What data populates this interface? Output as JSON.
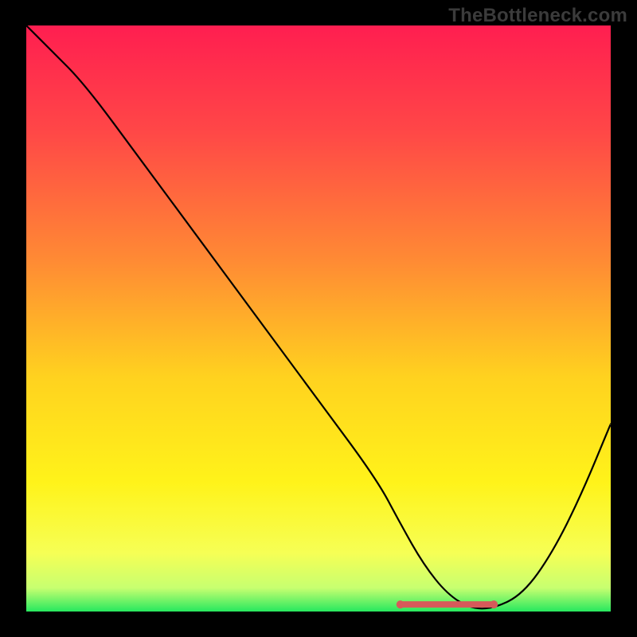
{
  "watermark": "TheBottleneck.com",
  "gradient": {
    "stops": [
      {
        "pct": 0,
        "color": "#ff1e50"
      },
      {
        "pct": 18,
        "color": "#ff4747"
      },
      {
        "pct": 40,
        "color": "#ff8a34"
      },
      {
        "pct": 60,
        "color": "#ffd21f"
      },
      {
        "pct": 78,
        "color": "#fff31a"
      },
      {
        "pct": 90,
        "color": "#f6ff55"
      },
      {
        "pct": 96,
        "color": "#c7ff70"
      },
      {
        "pct": 100,
        "color": "#27e85f"
      }
    ]
  },
  "curve": {
    "stroke": "#000000",
    "stroke_width": 2.2
  },
  "highlight": {
    "stroke": "#d65a5a",
    "stroke_width": 8,
    "cap_radius": 5
  },
  "chart_data": {
    "type": "line",
    "title": "",
    "xlabel": "",
    "ylabel": "",
    "xlim": [
      0,
      100
    ],
    "ylim": [
      0,
      100
    ],
    "grid": false,
    "legend": false,
    "annotations": [],
    "series": [
      {
        "name": "bottleneck-curve",
        "x": [
          0,
          4,
          10,
          20,
          30,
          40,
          50,
          60,
          64,
          68,
          72,
          76,
          80,
          85,
          90,
          95,
          100
        ],
        "y": [
          100,
          96,
          90,
          76.5,
          63,
          49.5,
          36,
          22.5,
          15,
          8,
          3,
          0.5,
          0.5,
          3,
          10,
          20,
          32
        ]
      },
      {
        "name": "optimal-range-highlight",
        "x": [
          64,
          80
        ],
        "y": [
          1.2,
          1.2
        ]
      }
    ],
    "highlight_range": {
      "x_start": 64,
      "x_end": 80
    }
  }
}
